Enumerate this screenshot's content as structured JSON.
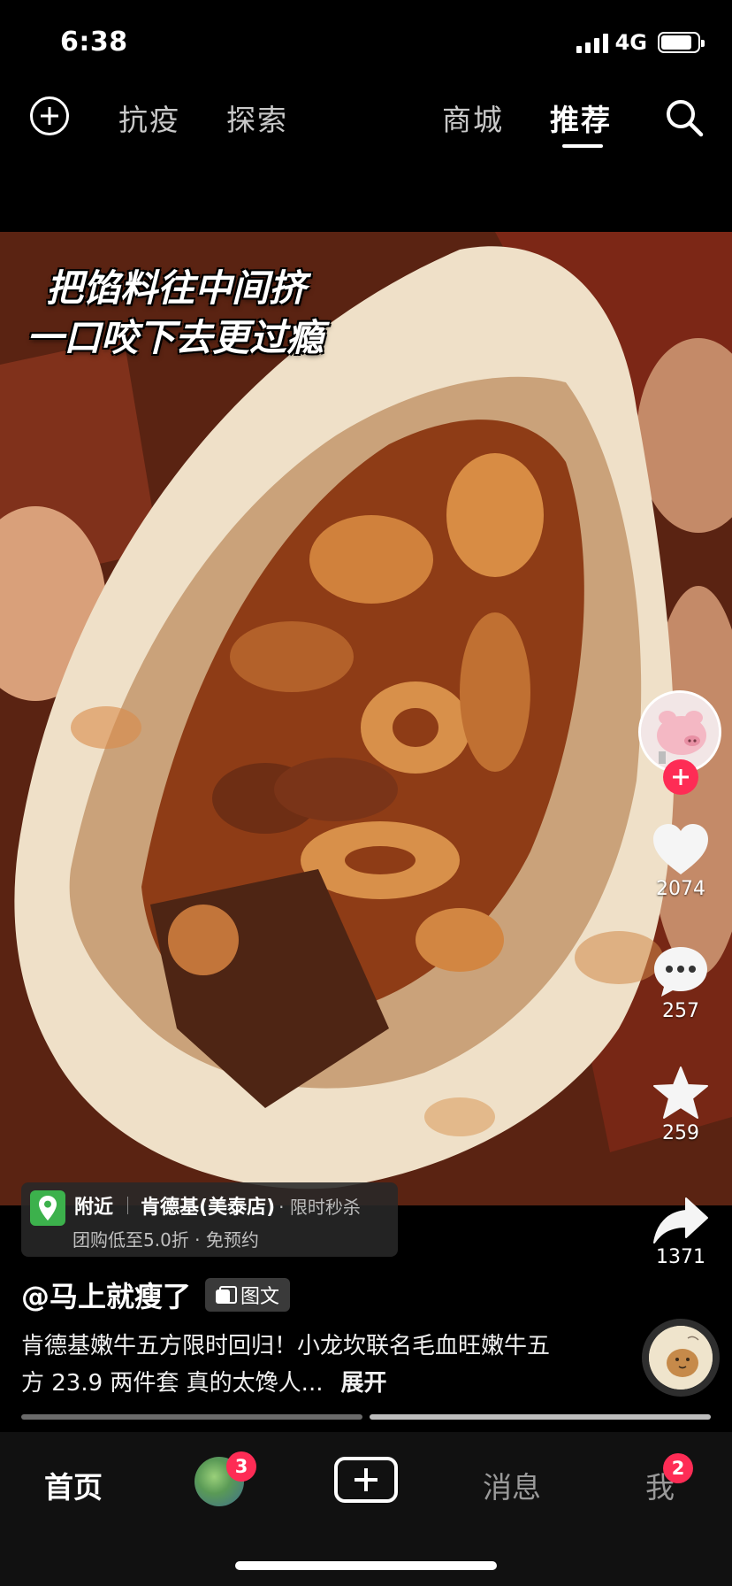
{
  "status_bar": {
    "time": "6:38",
    "network": "4G",
    "battery_level": 0.85
  },
  "top_nav": {
    "tabs": [
      {
        "label": "抗疫",
        "active": false
      },
      {
        "label": "探索",
        "active": false
      },
      {
        "label": "商城",
        "active": false
      },
      {
        "label": "推荐",
        "active": true
      }
    ],
    "icons": [
      "add-icon",
      "search-icon"
    ]
  },
  "post": {
    "overlay_caption": [
      "把馅料往中间挤",
      "一口咬下去更过瘾"
    ],
    "location": {
      "label": "附近",
      "shop": "肯德基(美泰店)",
      "promo": "· 限时秒杀",
      "deal": "团购低至5.0折 · 免预约"
    },
    "author": "@马上就瘦了",
    "type_badge": "图文",
    "description": "肯德基嫩牛五方限时回归！小龙坎联名毛血旺嫩牛五方 23.9 两件套 真的太馋人...",
    "expand_label": "展开",
    "page_count": 2,
    "active_page": 2
  },
  "actions": {
    "likes": "2074",
    "comments": "257",
    "favorites": "259",
    "shares": "1371"
  },
  "tab_bar": {
    "home": "首页",
    "friends_badge": "3",
    "messages": "消息",
    "me": "我",
    "me_badge": "2"
  },
  "colors": {
    "accent": "#fe2c55",
    "location_green": "#3cb14c",
    "background": "#000000"
  }
}
